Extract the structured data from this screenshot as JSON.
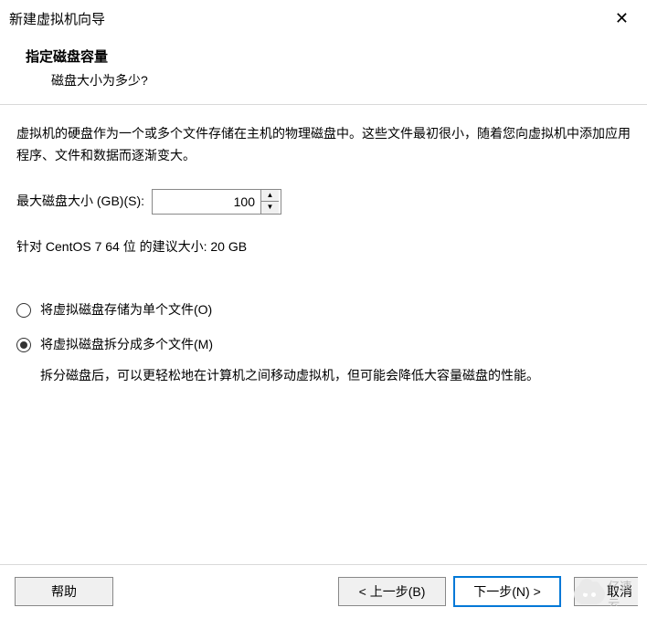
{
  "window": {
    "title": "新建虚拟机向导",
    "close_glyph": "✕"
  },
  "header": {
    "title": "指定磁盘容量",
    "subtitle": "磁盘大小为多少?"
  },
  "body": {
    "description": "虚拟机的硬盘作为一个或多个文件存储在主机的物理磁盘中。这些文件最初很小，随着您向虚拟机中添加应用程序、文件和数据而逐渐变大。",
    "size_label": "最大磁盘大小 (GB)(S):",
    "size_value": "100",
    "recommendation": "针对 CentOS 7 64 位 的建议大小: 20 GB",
    "radio_single": "将虚拟磁盘存储为单个文件(O)",
    "radio_split": "将虚拟磁盘拆分成多个文件(M)",
    "split_hint": "拆分磁盘后，可以更轻松地在计算机之间移动虚拟机，但可能会降低大容量磁盘的性能。"
  },
  "footer": {
    "help": "帮助",
    "back": "< 上一步(B)",
    "next": "下一步(N) >",
    "cancel": "取消"
  },
  "watermark": {
    "text": "亿速云"
  }
}
